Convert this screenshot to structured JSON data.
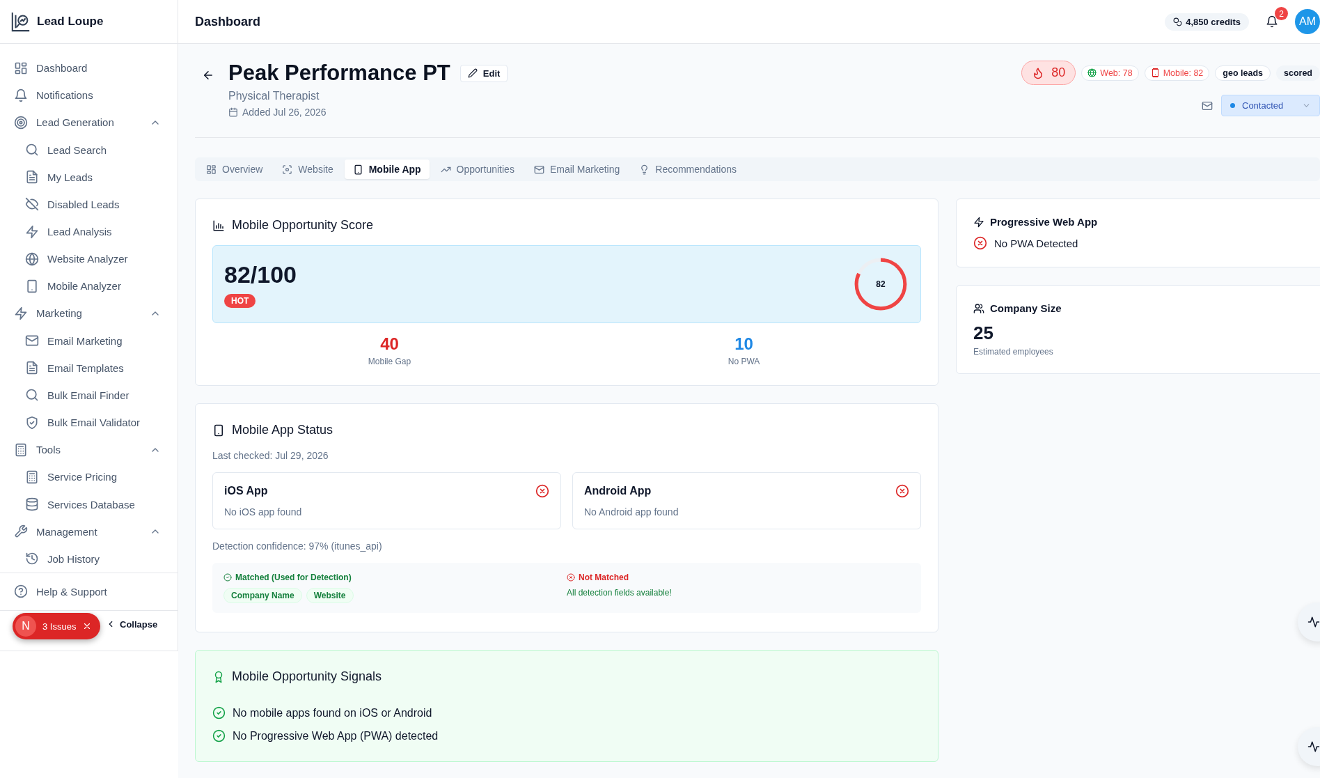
{
  "app": {
    "name": "Lead Loupe"
  },
  "header": {
    "title": "Dashboard",
    "credits": "4,850 credits",
    "notification_count": "2",
    "avatar": "AM"
  },
  "sidebar": {
    "items": [
      {
        "label": "Dashboard"
      },
      {
        "label": "Notifications"
      },
      {
        "label": "Lead Generation",
        "expanded": true,
        "children": [
          {
            "label": "Lead Search"
          },
          {
            "label": "My Leads"
          },
          {
            "label": "Disabled Leads"
          },
          {
            "label": "Lead Analysis"
          },
          {
            "label": "Website Analyzer"
          },
          {
            "label": "Mobile Analyzer"
          }
        ]
      },
      {
        "label": "Marketing",
        "expanded": true,
        "children": [
          {
            "label": "Email Marketing"
          },
          {
            "label": "Email Templates"
          },
          {
            "label": "Bulk Email Finder"
          },
          {
            "label": "Bulk Email Validator"
          }
        ]
      },
      {
        "label": "Tools",
        "expanded": true,
        "children": [
          {
            "label": "Service Pricing"
          },
          {
            "label": "Services Database"
          }
        ]
      },
      {
        "label": "Management",
        "expanded": true,
        "children": [
          {
            "label": "Job History"
          }
        ]
      }
    ],
    "footer": {
      "help": "Help & Support",
      "collapse": "Collapse"
    }
  },
  "issues_badge": {
    "avatar": "N",
    "label": "3 Issues"
  },
  "lead": {
    "name": "Peak Performance PT",
    "edit": "Edit",
    "category": "Physical Therapist",
    "added": "Added Jul 26, 2026",
    "score": "80",
    "scores": [
      {
        "label": "Web:",
        "value": "78",
        "color": "#16a34a"
      },
      {
        "label": "Mobile:",
        "value": "82",
        "color": "#dc2626"
      }
    ],
    "tags": [
      {
        "label": "geo leads",
        "selected": false
      },
      {
        "label": "scored",
        "selected": true
      }
    ],
    "status": "Contacted"
  },
  "tabs": [
    {
      "label": "Overview",
      "selected": false
    },
    {
      "label": "Website",
      "selected": false
    },
    {
      "label": "Mobile App",
      "selected": true
    },
    {
      "label": "Opportunities",
      "selected": false
    },
    {
      "label": "Email Marketing",
      "selected": false
    },
    {
      "label": "Recommendations",
      "selected": false
    }
  ],
  "score_card": {
    "title": "Mobile Opportunity Score",
    "score": "82/100",
    "badge": "HOT",
    "gauge": {
      "level": 0.82,
      "label": "82"
    },
    "stats": [
      {
        "value": "40",
        "label": "Mobile Gap",
        "color": "#dc2626"
      },
      {
        "value": "10",
        "label": "No PWA",
        "color": "#1e88e5"
      }
    ]
  },
  "status_card": {
    "title": "Mobile App Status",
    "last_checked": "Last checked: Jul 29, 2026",
    "apps": [
      {
        "name": "iOS App",
        "status": "No iOS app found",
        "found": false
      },
      {
        "name": "Android App",
        "status": "No Android app found",
        "found": false
      }
    ],
    "confidence": "Detection confidence: 97% (itunes_api)",
    "matched": {
      "title": "Matched (Used for Detection)",
      "fields": [
        "Company Name",
        "Website"
      ]
    },
    "not_matched": {
      "title": "Not Matched",
      "message": "All detection fields available!"
    }
  },
  "signals_card": {
    "title": "Mobile Opportunity Signals",
    "items": [
      {
        "text": "No mobile apps found on iOS or Android",
        "checked": true
      },
      {
        "text": "No Progressive Web App (PWA) detected",
        "checked": true
      }
    ]
  },
  "pwa_card": {
    "title": "Progressive Web App",
    "status": "No PWA Detected",
    "detected": false
  },
  "size_card": {
    "title": "Company Size",
    "value": "25",
    "caption": "Estimated employees"
  }
}
